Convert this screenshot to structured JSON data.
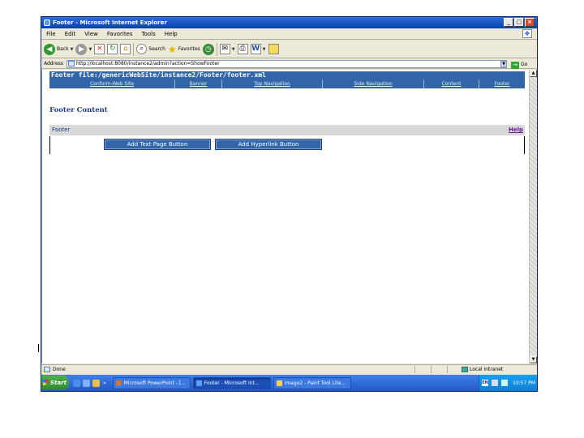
{
  "window": {
    "title": "Footer - Microsoft Internet Explorer",
    "controls": [
      "_",
      "□",
      "×"
    ]
  },
  "menubar": {
    "items": [
      "File",
      "Edit",
      "View",
      "Favorites",
      "Tools",
      "Help"
    ]
  },
  "toolbar": {
    "back_label": "Back",
    "search_label": "Search",
    "favorites_label": "Favorites"
  },
  "address": {
    "label": "Address",
    "url": "http://localhost:8080/instance2/admin?action=ShowFooter",
    "go_label": "Go"
  },
  "page": {
    "path_title": "Footer file:/genericWebSite/instance2/Footer/footer.xml",
    "nav": [
      "Conform-Web Site",
      "Banner",
      "Top Navigation",
      "Side Navigation",
      "Content",
      "Footer"
    ],
    "heading": "Footer Content",
    "section_label": "Footer",
    "help_label": "Help",
    "buttons": {
      "add_text_page": "Add Text Page Button",
      "add_hyperlink": "Add Hyperlink Button"
    }
  },
  "statusbar": {
    "status": "Done",
    "zone": "Local intranet"
  },
  "taskbar": {
    "start_label": "Start",
    "tasks": [
      "Microsoft PowerPoint - [...",
      "Footer - Microsoft Int...",
      "image2 - Paint Tool Lite..."
    ],
    "clock": "10:57 PM",
    "tray_lang": "EN"
  },
  "colors": {
    "header_blue": "#3366a8",
    "title_blue": "#0a3fb0",
    "taskbar_blue": "#2457c7",
    "help_purple": "#6a1b9a"
  }
}
